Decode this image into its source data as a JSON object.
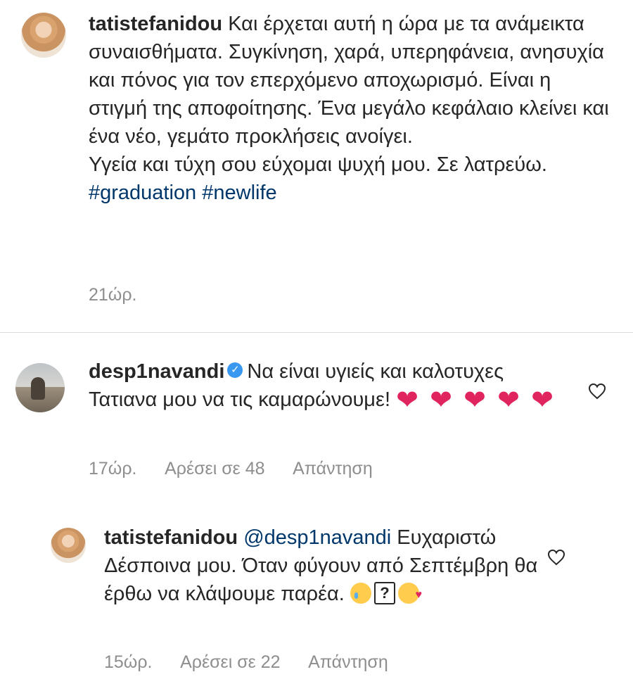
{
  "post": {
    "username": "tatistefanidou",
    "caption_lines": [
      "Και έρχεται αυτή η ώρα με τα ανάμεικτα συναισθήματα. Συγκίνηση, χαρά, υπερηφάνεια, ανησυχία και πόνος για τον επερχόμενο αποχωρισμό. Είναι η στιγμή της αποφοίτησης. Ένα μεγάλο κεφάλαιο κλείνει και ένα νέο, γεμάτο προκλήσεις ανοίγει.",
      "Υγεία και τύχη σου εύχομαι ψυχή μου. Σε λατρεύω."
    ],
    "hashtags": "#graduation #newlife",
    "time": "21ώρ."
  },
  "comment": {
    "username": "desp1navandi",
    "verified_icon": "verified-badge-icon",
    "text": "Να είναι υγιείς και καλοτυχες Τατιανα μου να τις καμαρώνουμε!",
    "emoji_hearts": [
      "❤",
      "❤",
      "❤",
      "❤",
      "❤"
    ],
    "time": "17ώρ.",
    "likes": "Αρέσει σε 48",
    "reply": "Απάντηση"
  },
  "reply": {
    "username": "tatistefanidou",
    "mention": "@desp1navandi",
    "text": "Ευχαριστώ Δέσποινα μου. Όταν φύγουν από Σεπτέμβρη θα έρθω να κλάψουμε παρέα.",
    "emoji_box": "?",
    "time": "15ώρ.",
    "likes": "Αρέσει σε 22",
    "reply": "Απάντηση"
  },
  "colors": {
    "text": "#262626",
    "link": "#00376b",
    "meta": "#8e8e8e",
    "heart": "#e0245e",
    "verified": "#3897f0"
  }
}
